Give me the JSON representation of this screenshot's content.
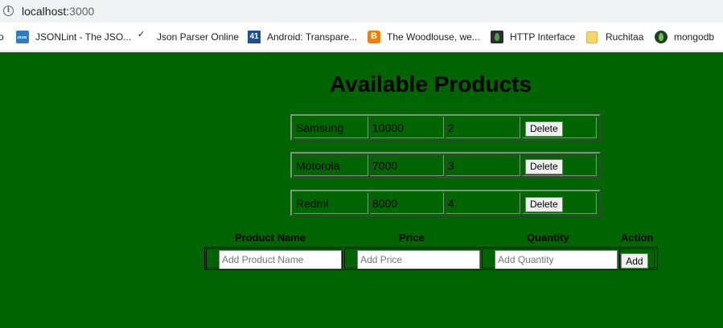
{
  "browser": {
    "url_host": "localhost:",
    "url_port": "3000",
    "bookmarks": [
      {
        "label": "o",
        "icon": "cut-off-icon"
      },
      {
        "label": "JSONLint - The JSO...",
        "icon": "jsonlint-icon"
      },
      {
        "label": "Json Parser Online",
        "icon": "json-parser-icon"
      },
      {
        "label": "Android: Transpare...",
        "icon": "android-bookmark-icon"
      },
      {
        "label": "The Woodlouse, we...",
        "icon": "blogger-icon"
      },
      {
        "label": "HTTP Interface",
        "icon": "mongodb-leaf-icon"
      },
      {
        "label": "Ruchitaa",
        "icon": "folder-icon"
      },
      {
        "label": "mongodb",
        "icon": "mongodb-icon"
      }
    ]
  },
  "page": {
    "title": "Available Products",
    "background": "#006400",
    "products": [
      {
        "name": "Samsung",
        "price": "10000",
        "quantity": "2",
        "action": "Delete"
      },
      {
        "name": "Motorola",
        "price": "7000",
        "quantity": "3",
        "action": "Delete"
      },
      {
        "name": "Redmi",
        "price": "8000",
        "quantity": "4",
        "action": "Delete"
      }
    ],
    "form": {
      "headers": {
        "name": "Product Name",
        "price": "Price",
        "quantity": "Quantity",
        "action": "Action"
      },
      "placeholders": {
        "name": "Add Product Name",
        "price": "Add Price",
        "quantity": "Add Quantity"
      },
      "values": {
        "name": "",
        "price": "",
        "quantity": ""
      },
      "add_label": "Add"
    }
  }
}
